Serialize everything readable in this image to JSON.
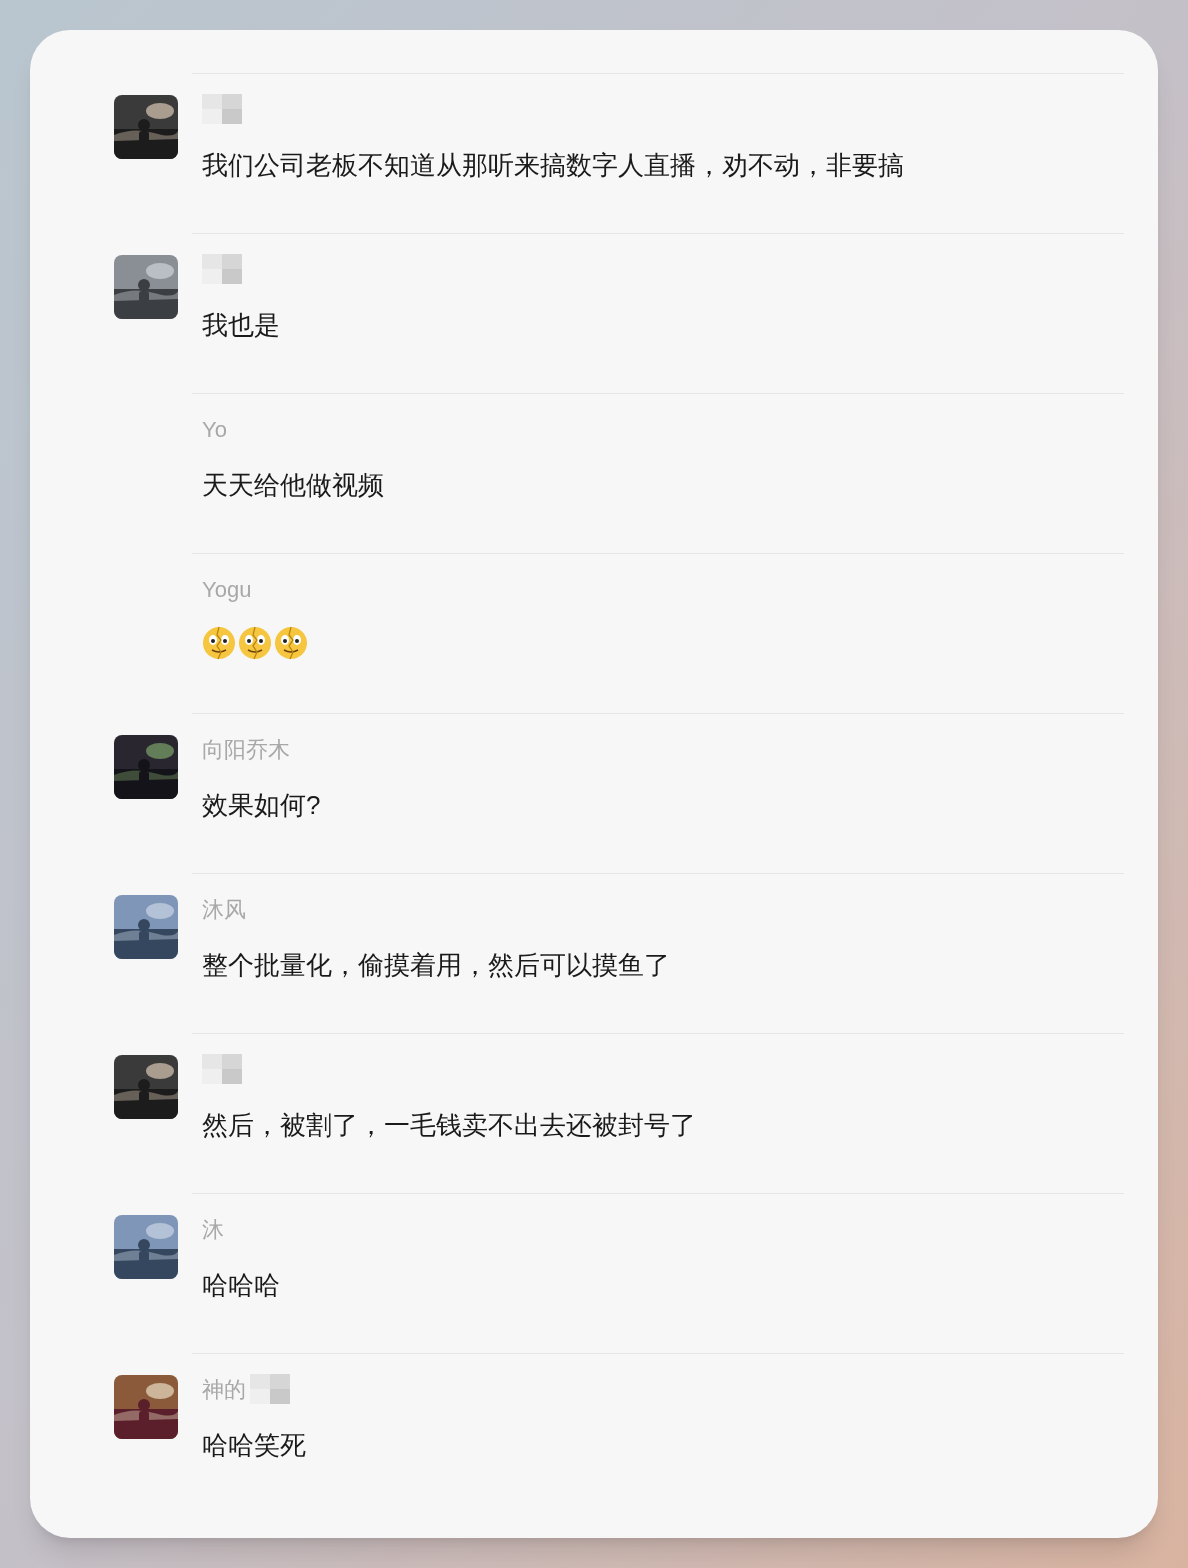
{
  "messages": [
    {
      "name_redacted": true,
      "kind": "text",
      "text": "我们公司老板不知道从那听来搞数字人直播，劝不动，非要搞"
    },
    {
      "name_redacted": true,
      "kind": "text",
      "text": "我也是"
    },
    {
      "name": "Yo",
      "kind": "text",
      "text": "天天给他做视频"
    },
    {
      "name": "Yogu",
      "kind": "stickers",
      "stickers": [
        {
          "kind": "cracked-face"
        },
        {
          "kind": "cracked-face"
        },
        {
          "kind": "cracked-face"
        }
      ]
    },
    {
      "name": "向阳乔木",
      "kind": "text",
      "text": "效果如何?"
    },
    {
      "name": "沐风",
      "kind": "text",
      "text": "整个批量化，偷摸着用，然后可以摸鱼了"
    },
    {
      "name_redacted": true,
      "kind": "text",
      "text": "然后，被割了，一毛钱卖不出去还被封号了"
    },
    {
      "name": "沐",
      "kind": "text",
      "text": "哈哈哈"
    },
    {
      "name": "神的",
      "name_redacted": true,
      "kind": "text",
      "text": "哈哈笑死"
    }
  ]
}
